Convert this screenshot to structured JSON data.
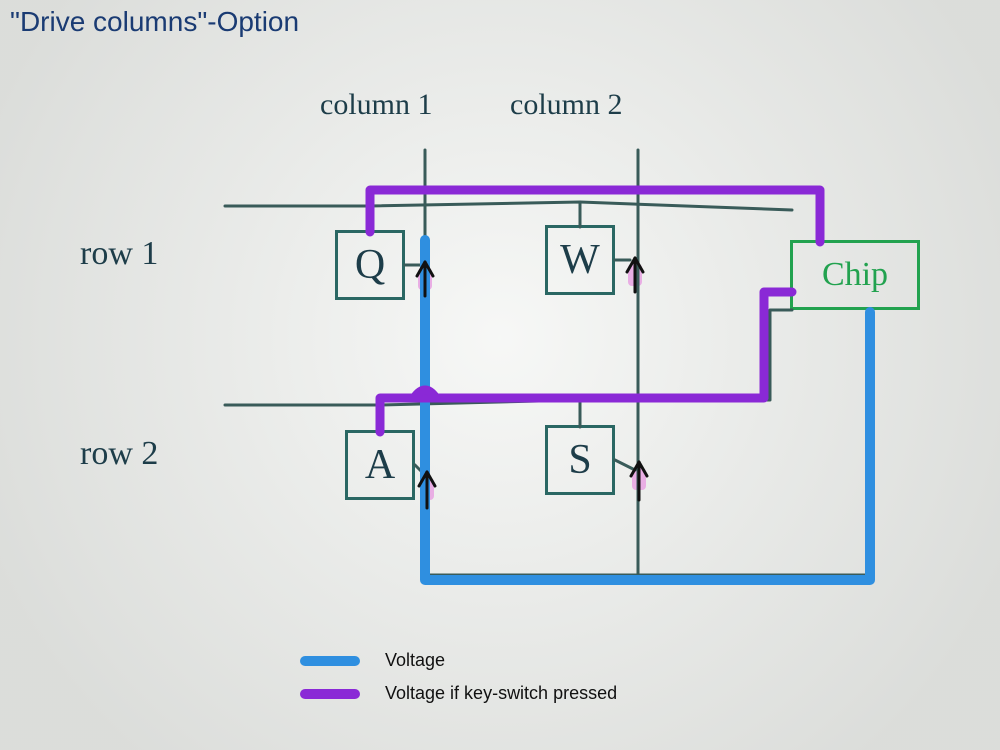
{
  "title": "\"Drive columns\"-Option",
  "columns": {
    "c1": "column 1",
    "c2": "column 2"
  },
  "rows": {
    "r1": "row 1",
    "r2": "row 2"
  },
  "keys": {
    "q": "Q",
    "w": "W",
    "a": "A",
    "s": "S"
  },
  "chip": "Chip",
  "legend": {
    "voltage": "Voltage",
    "pressed": "Voltage if key-switch pressed"
  },
  "colors": {
    "voltage": "#2f8fe0",
    "pressed": "#8a29d6",
    "pen": "#395b59",
    "arrow": "#111111"
  },
  "diagram": {
    "description": "Keyboard matrix 'drive columns' scan option. Chip drives a column line (blue). If a key-switch on that column is pressed, the corresponding row line goes high (purple). Diodes on each switch prevent ghosting; arrows show diode direction (row side).",
    "matrix": [
      {
        "row": 1,
        "col": 1,
        "key": "Q"
      },
      {
        "row": 1,
        "col": 2,
        "key": "W"
      },
      {
        "row": 2,
        "col": 1,
        "key": "A"
      },
      {
        "row": 2,
        "col": 2,
        "key": "S"
      }
    ],
    "driven_column_example": 1,
    "sensed_rows_if_pressed": [
      1,
      2
    ]
  }
}
